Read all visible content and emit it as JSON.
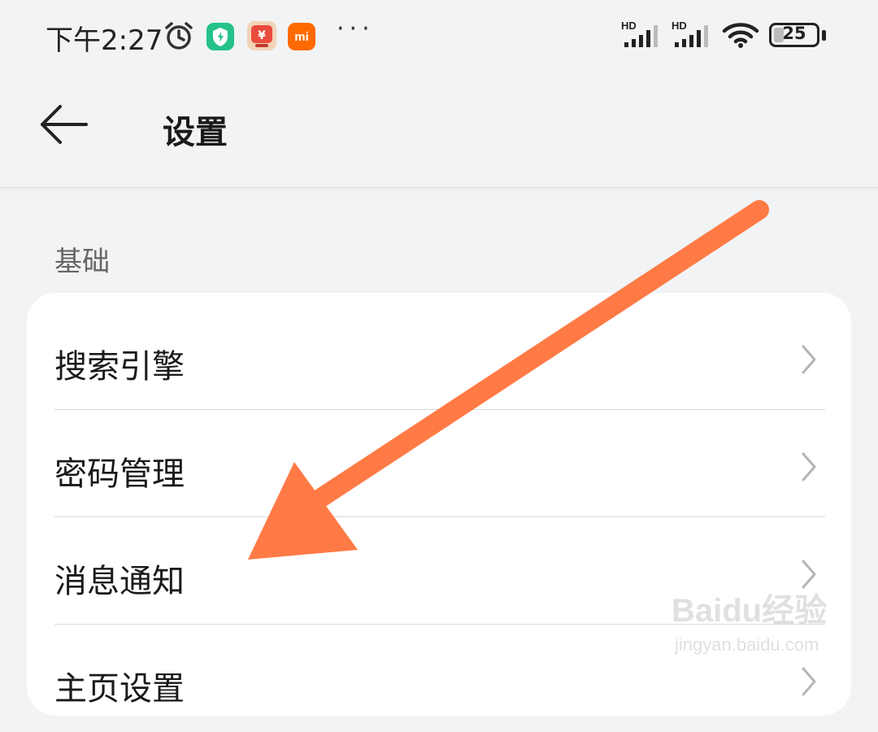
{
  "status_bar": {
    "time": "下午2:27",
    "app3_label": "mi",
    "more": "···",
    "signal1": "HD",
    "signal2": "HD",
    "battery": "25",
    "icons": [
      "alarm-icon",
      "security-app-icon",
      "shopping-app-icon",
      "mi-app-icon",
      "signal-icon",
      "wifi-icon",
      "battery-icon"
    ]
  },
  "header": {
    "title": "设置"
  },
  "section": {
    "label": "基础",
    "items": [
      {
        "label": "搜索引擎"
      },
      {
        "label": "密码管理"
      },
      {
        "label": "消息通知"
      },
      {
        "label": "主页设置"
      }
    ]
  },
  "watermark": {
    "main": "Baidu经验",
    "sub": "jingyan.baidu.com"
  },
  "colors": {
    "background": "#f1f3f5",
    "card": "#ffffff",
    "arrow": "#ff7a45"
  }
}
